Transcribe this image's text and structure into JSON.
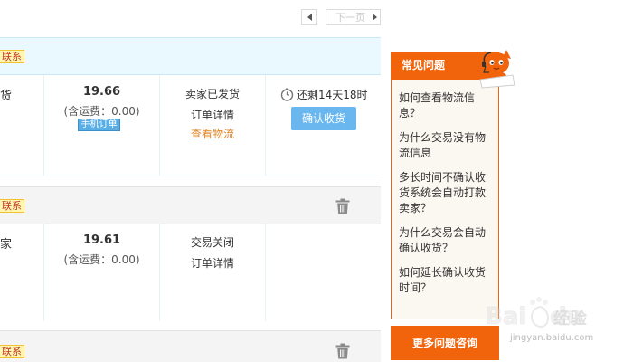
{
  "pager": {
    "next_label": "下一页"
  },
  "orders": [
    {
      "edge_text": "货",
      "price": "19.66",
      "shipping": "(含运费：0.00)",
      "mobile_tag": "手机订单",
      "status": "卖家已发货",
      "detail": "订单详情",
      "logistics": "查看物流",
      "remaining": "还剩14天18时",
      "confirm": "确认收货"
    },
    {
      "edge_text": "家",
      "price": "19.61",
      "shipping": "(含运费：0.00)",
      "status": "交易关闭",
      "detail": "订单详情"
    }
  ],
  "badges": [
    "联系",
    "联系",
    "联系"
  ],
  "faq": {
    "title": "常见问题",
    "items": [
      "如何查看物流信息？",
      "为什么交易没有物流信息",
      "多长时间不确认收货系统会自动打款卖家？",
      "为什么交易会自动确认收货？",
      "如何延长确认收货时间？"
    ],
    "more": "更多问题咨询"
  },
  "watermark": {
    "text": "Baidu经验",
    "url": "jingyan.baidu.com"
  },
  "colors": {
    "accent": "#f2640b",
    "button": "#6ab7f0",
    "link": "#e0872b",
    "header_blue": "#eaf8ff"
  },
  "icons": {
    "prev": "triangle-left-icon",
    "next": "triangle-right-icon",
    "trash": "trash-icon",
    "clock": "clock-icon"
  }
}
